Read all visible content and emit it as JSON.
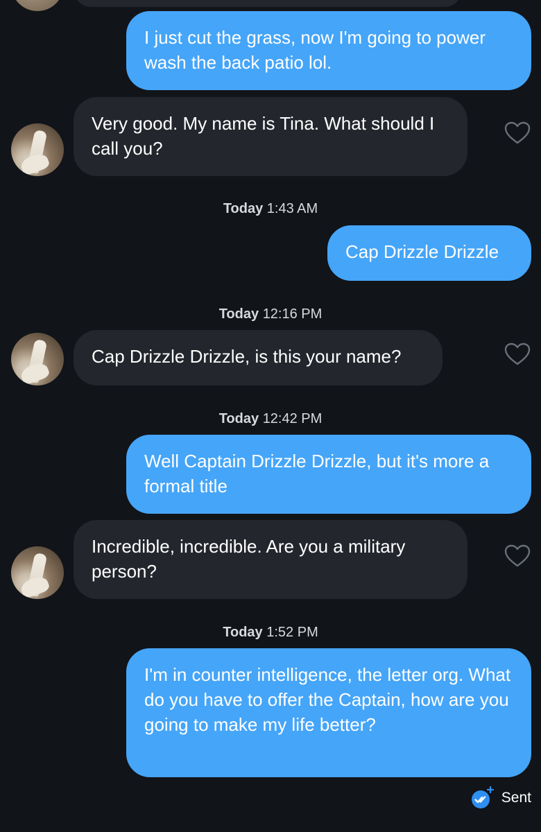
{
  "conversation": {
    "messages": [
      {
        "id": "m1",
        "direction": "outgoing",
        "text": "I just cut the grass, now I'm going to power wash the back patio lol."
      },
      {
        "id": "m2",
        "direction": "incoming",
        "text": "Very good. My name is Tina. What should I call you?"
      },
      {
        "id": "m3",
        "direction": "outgoing",
        "text": "Cap Drizzle Drizzle"
      },
      {
        "id": "m4",
        "direction": "incoming",
        "text": "Cap Drizzle Drizzle, is this your name?"
      },
      {
        "id": "m5",
        "direction": "outgoing",
        "text": "Well Captain Drizzle Drizzle, but it's more a formal title"
      },
      {
        "id": "m6",
        "direction": "incoming",
        "text": "Incredible, incredible. Are you a military person?"
      },
      {
        "id": "m7",
        "direction": "outgoing",
        "text": "I'm in counter intelligence, the letter org. What do you have to offer the Captain, how are you going to make my life better?"
      }
    ],
    "timestamps": [
      {
        "day": "Today",
        "time": "1:43 AM"
      },
      {
        "day": "Today",
        "time": "12:16 PM"
      },
      {
        "day": "Today",
        "time": "12:42 PM"
      },
      {
        "day": "Today",
        "time": "1:52 PM"
      }
    ],
    "status": {
      "label": "Sent",
      "icon": "sent-check-icon"
    }
  },
  "colors": {
    "background": "#111419",
    "outgoing_bubble": "#45a5f8",
    "incoming_bubble": "#23262d",
    "text": "#ffffff",
    "heart_outline": "#6b6f78"
  }
}
